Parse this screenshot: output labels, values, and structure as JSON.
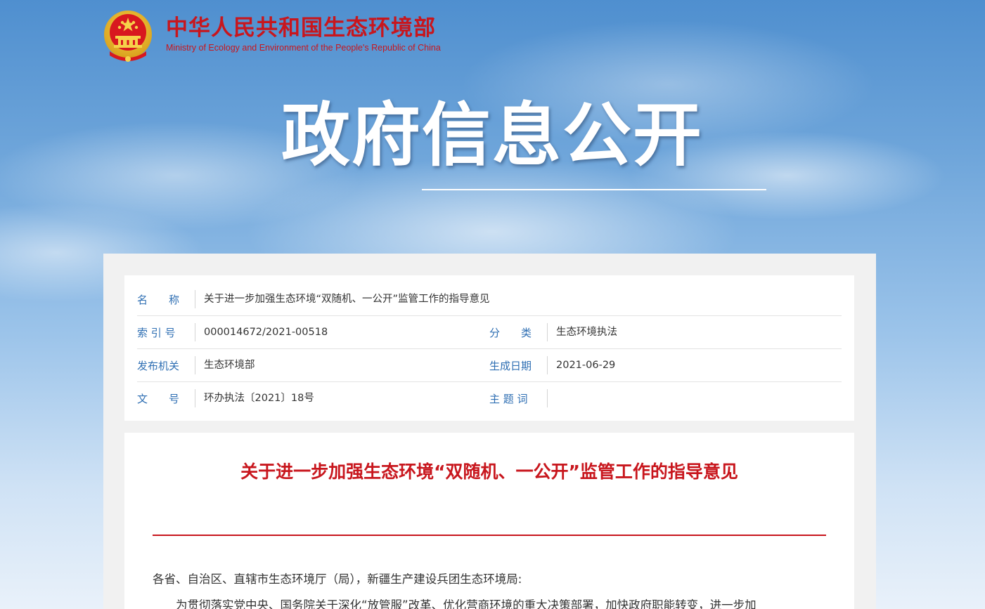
{
  "header": {
    "ministry_cn": "中华人民共和国生态环境部",
    "ministry_en": "Ministry of Ecology and Environment of the People's Republic of China"
  },
  "banner": {
    "title": "政府信息公开"
  },
  "info": {
    "name_label": "名　　称",
    "name_value": "关于进一步加强生态环境“双随机、一公开”监管工作的指导意见",
    "index_label": "索 引 号",
    "index_value": "000014672/2021-00518",
    "category_label": "分　　类",
    "category_value": "生态环境执法",
    "issuer_label": "发布机关",
    "issuer_value": "生态环境部",
    "date_label": "生成日期",
    "date_value": "2021-06-29",
    "docno_label": "文　　号",
    "docno_value": "环办执法〔2021〕18号",
    "keywords_label": "主 题 词",
    "keywords_value": ""
  },
  "article": {
    "title": "关于进一步加强生态环境“双随机、一公开”监管工作的指导意见",
    "salutation": "各省、自治区、直辖市生态环境厅（局），新疆生产建设兵团生态环境局:",
    "para1": "　　为贯彻落实党中央、国务院关于深化“放管服”改革、优化营商环境的重大决策部署，加快政府职能转变，进一步加"
  },
  "colors": {
    "brand_red": "#c8161d",
    "label_blue": "#2f6fb3"
  }
}
